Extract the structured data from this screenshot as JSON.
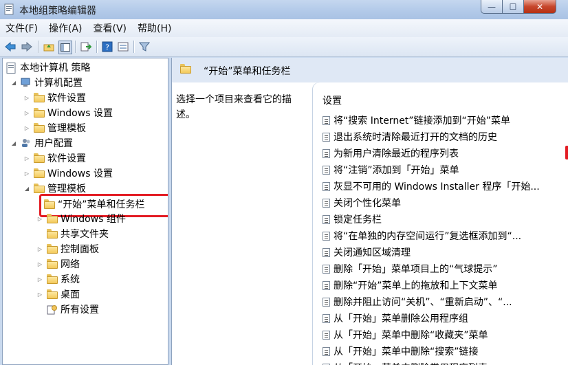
{
  "window": {
    "title": "本地组策略编辑器"
  },
  "window_buttons": {
    "minimize": "—",
    "maximize": "☐",
    "close": "✕"
  },
  "menu": [
    "文件(F)",
    "操作(A)",
    "查看(V)",
    "帮助(H)"
  ],
  "toolbar_icons": [
    "back-arrow-icon",
    "forward-arrow-icon",
    "up-folder-icon",
    "show-hide-tree-icon",
    "export-list-icon",
    "help-icon",
    "properties-icon",
    "filter-icon"
  ],
  "tree": {
    "root": "本地计算机 策略",
    "computer_config": "计算机配置",
    "cc_software": "软件设置",
    "cc_windows": "Windows 设置",
    "cc_admin": "管理模板",
    "user_config": "用户配置",
    "uc_software": "软件设置",
    "uc_windows": "Windows 设置",
    "uc_admin": "管理模板",
    "start_menu": "“开始”菜单和任务栏",
    "windows_components": "Windows 组件",
    "shared_folders": "共享文件夹",
    "control_panel": "控制面板",
    "network": "网络",
    "system": "系统",
    "desktop": "桌面",
    "all_settings": "所有设置"
  },
  "right_pane": {
    "header": "“开始”菜单和任务栏",
    "description": "选择一个项目来查看它的描述。",
    "column_header": "设置",
    "settings": [
      "将“搜索 Internet”链接添加到“开始”菜单",
      "退出系统时清除最近打开的文档的历史",
      "为新用户清除最近的程序列表",
      "将“注销”添加到「开始」菜单",
      "灰显不可用的 Windows Installer 程序「开始...",
      "关闭个性化菜单",
      "锁定任务栏",
      "将“在单独的内存空间运行”复选框添加到“...",
      "关闭通知区域清理",
      "删除「开始」菜单项目上的“气球提示”",
      "删除“开始”菜单上的拖放和上下文菜单",
      "删除并阻止访问“关机”、“重新启动”、“...",
      "从「开始」菜单删除公用程序组",
      "从「开始」菜单中删除“收藏夹”菜单",
      "从「开始」菜单中删除“搜索”链接",
      "从「开始」菜单中删除常用程序列表"
    ]
  }
}
